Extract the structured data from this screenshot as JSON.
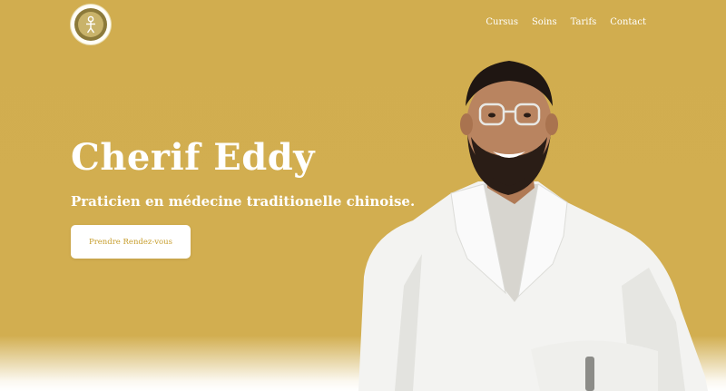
{
  "brand": {
    "logo_icon": "acupuncture-figure-icon"
  },
  "nav": {
    "items": [
      {
        "label": "Cursus"
      },
      {
        "label": "Soins"
      },
      {
        "label": "Tarifs"
      },
      {
        "label": "Contact"
      }
    ]
  },
  "hero": {
    "title": "Cherif Eddy",
    "subtitle": "Praticien en médecine traditionelle chinoise.",
    "cta_label": "Prendre Rendez-vous"
  },
  "colors": {
    "background": "#d1ad4f",
    "cta_text": "#c79e2e",
    "text": "#ffffff"
  }
}
